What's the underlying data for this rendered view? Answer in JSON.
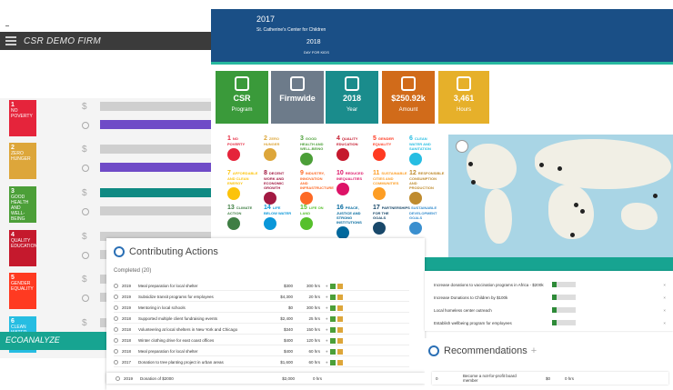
{
  "header": {
    "firm_name": "CSR DEMO FIRM"
  },
  "banner": {
    "year_1": "2017",
    "org_1": "St. Catherine's Center for Children",
    "year_2": "2018",
    "org_2": "DAY FOR KIDS"
  },
  "tiles": [
    {
      "value": "CSR",
      "label": "Program",
      "color": "#3a9a3a"
    },
    {
      "value": "Firmwide",
      "label": "",
      "color": "#6d7b8a"
    },
    {
      "value": "2018",
      "label": "Year",
      "color": "#1a8c8c"
    },
    {
      "value": "$250.92k",
      "label": "Amount",
      "color": "#d16b1a"
    },
    {
      "value": "3,461",
      "label": "Hours",
      "color": "#e6b02a"
    }
  ],
  "left_sdgs": [
    {
      "num": "1",
      "name": "NO POVERTY",
      "color": "#e5243b",
      "bar_color": "#cfcfcf",
      "bar2_color": "#6f4bc7"
    },
    {
      "num": "2",
      "name": "ZERO HUNGER",
      "color": "#dda63a",
      "bar_color": "#cfcfcf",
      "bar2_color": "#6f4bc7"
    },
    {
      "num": "3",
      "name": "GOOD HEALTH AND WELL-BEING",
      "color": "#4c9f38",
      "bar_color": "#108a83",
      "bar2_color": "#cfcfcf"
    },
    {
      "num": "4",
      "name": "QUALITY EDUCATION",
      "color": "#c5192d",
      "bar_color": "#cfcfcf",
      "bar2_color": "#cfcfcf"
    },
    {
      "num": "5",
      "name": "GENDER EQUALITY",
      "color": "#ff3a21",
      "bar_color": "#cfcfcf",
      "bar2_color": "#cfcfcf"
    },
    {
      "num": "6",
      "name": "CLEAN WATER AND SANITATION",
      "color": "#26bde2",
      "bar_color": "#cfcfcf",
      "bar2_color": "#cfcfcf"
    }
  ],
  "sdg_grid": [
    {
      "num": "1",
      "name": "NO POVERTY",
      "color": "#e5243b"
    },
    {
      "num": "2",
      "name": "ZERO HUNGER",
      "color": "#dda63a"
    },
    {
      "num": "3",
      "name": "GOOD HEALTH AND WELL-BEING",
      "color": "#4c9f38"
    },
    {
      "num": "4",
      "name": "QUALITY EDUCATION",
      "color": "#c5192d"
    },
    {
      "num": "5",
      "name": "GENDER EQUALITY",
      "color": "#ff3a21"
    },
    {
      "num": "6",
      "name": "CLEAN WATER AND SANITATION",
      "color": "#26bde2"
    },
    {
      "num": "7",
      "name": "AFFORDABLE AND CLEAN ENERGY",
      "color": "#fcc30b"
    },
    {
      "num": "8",
      "name": "DECENT WORK AND ECONOMIC GROWTH",
      "color": "#a21942"
    },
    {
      "num": "9",
      "name": "INDUSTRY, INNOVATION AND INFRASTRUCTURE",
      "color": "#fd6925"
    },
    {
      "num": "10",
      "name": "REDUCED INEQUALITIES",
      "color": "#dd1367"
    },
    {
      "num": "11",
      "name": "SUSTAINABLE CITIES AND COMMUNITIES",
      "color": "#fd9d24"
    },
    {
      "num": "12",
      "name": "RESPONSIBLE CONSUMPTION AND PRODUCTION",
      "color": "#bf8b2e"
    },
    {
      "num": "13",
      "name": "CLIMATE ACTION",
      "color": "#3f7e44"
    },
    {
      "num": "14",
      "name": "LIFE BELOW WATER",
      "color": "#0a97d9"
    },
    {
      "num": "15",
      "name": "LIFE ON LAND",
      "color": "#56c02b"
    },
    {
      "num": "16",
      "name": "PEACE, JUSTICE AND STRONG INSTITUTIONS",
      "color": "#00689d"
    },
    {
      "num": "17",
      "name": "PARTNERSHIPS FOR THE GOALS",
      "color": "#19486a"
    },
    {
      "num": "",
      "name": "SUSTAINABLE DEVELOPMENT GOALS",
      "color": "#ffffff"
    }
  ],
  "eco_label": "ECOANALYZE",
  "contributing": {
    "title": "Contributing Actions",
    "subtitle": "Completed (20)",
    "rows": [
      {
        "year": "2019",
        "name": "Meal preparation for local shelter",
        "amount": "$300",
        "hours": "300 hrs"
      },
      {
        "year": "2019",
        "name": "Subsidize transit programs for employees",
        "amount": "$4,300",
        "hours": "20 hrs"
      },
      {
        "year": "2019",
        "name": "Mentoring in local schools",
        "amount": "$0",
        "hours": "300 hrs"
      },
      {
        "year": "2018",
        "name": "Supported multiple client fundraising events",
        "amount": "$2,400",
        "hours": "25 hrs"
      },
      {
        "year": "2018",
        "name": "Volunteering at local shelters in New York and Chicago",
        "amount": "$340",
        "hours": "150 hrs"
      },
      {
        "year": "2018",
        "name": "Winter clothing drive for east coast offices",
        "amount": "$400",
        "hours": "120 hrs"
      },
      {
        "year": "2018",
        "name": "Meal preparation for local shelter",
        "amount": "$400",
        "hours": "60 hrs"
      },
      {
        "year": "2017",
        "name": "Donation to tree planting project in urban areas",
        "amount": "$1,600",
        "hours": "60 hrs"
      }
    ],
    "last_row": {
      "year": "2019",
      "name": "Donation of $2000",
      "amount": "$2,000",
      "hours": "0 hrs"
    }
  },
  "right_actions": [
    {
      "name": "Increase donations to vaccination programs in Africa - $200k"
    },
    {
      "name": "Increase Donations to Children by $100k"
    },
    {
      "name": "Local homeless center outreach"
    },
    {
      "name": "Establish wellbeing program for employees"
    }
  ],
  "recommendations": {
    "title": "Recommendations",
    "plus": "+",
    "row": {
      "count": "0",
      "name": "Become a not-for-profit board member",
      "amount": "$0",
      "hours": "0 hrs"
    }
  }
}
